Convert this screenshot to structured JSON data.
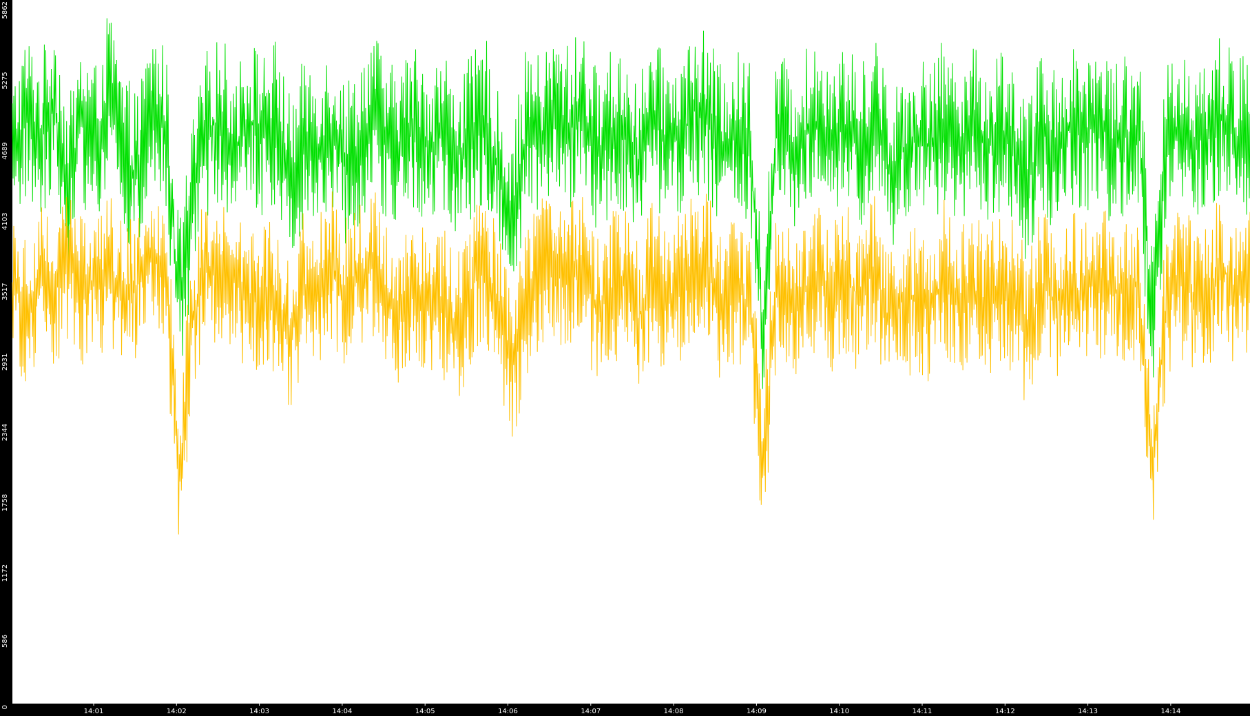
{
  "chart_data": {
    "type": "line",
    "title": "",
    "xlabel": "",
    "ylabel": "",
    "grid": false,
    "legend": "none",
    "x_range": [
      "14:00",
      "14:15"
    ],
    "ylim": [
      0,
      5862
    ],
    "y_ticks": [
      0,
      586,
      1172,
      1758,
      2344,
      2931,
      3517,
      4103,
      4689,
      5275,
      5862
    ],
    "x_ticks": [
      "14:01",
      "14:02",
      "14:03",
      "14:04",
      "14:05",
      "14:06",
      "14:07",
      "14:08",
      "14:09",
      "14:10",
      "14:11",
      "14:12",
      "14:13",
      "14:14"
    ],
    "series": [
      {
        "color": "#00e000",
        "values": [
          4500,
          4900,
          4700,
          5050,
          4300,
          4850,
          4650,
          5100,
          4550,
          4400,
          4950,
          4800,
          3300,
          4200,
          4750,
          4900,
          4600,
          4850,
          4750,
          4850,
          4350,
          4700,
          4650,
          4800,
          4500,
          4700,
          4950,
          4600,
          4700,
          4800,
          4650,
          4750,
          4550,
          4700,
          4900,
          4350,
          4100,
          4800,
          4700,
          4900,
          4800,
          4950,
          4600,
          4750,
          4800,
          4500,
          4850,
          4700,
          4700,
          4950,
          4900,
          4600,
          4750,
          4700,
          3100,
          4800,
          4600,
          4750,
          4850,
          4750,
          4800,
          4600,
          5000,
          4400,
          4600,
          4700,
          4650,
          4850,
          4700,
          4800,
          4650,
          4800,
          4700,
          4300,
          4750,
          4650,
          4800,
          4750,
          4850,
          4700,
          4750,
          4800,
          3100,
          4650,
          4800,
          4700,
          4750,
          4900,
          4700,
          4750
        ]
      },
      {
        "color": "#ffc000",
        "values": [
          3500,
          3300,
          3550,
          3400,
          3700,
          3450,
          3550,
          3600,
          3350,
          3500,
          3700,
          3600,
          1900,
          3200,
          3650,
          3500,
          3550,
          3400,
          3450,
          3400,
          3050,
          3500,
          3400,
          3650,
          3400,
          3550,
          3650,
          3350,
          3300,
          3500,
          3400,
          3350,
          3150,
          3450,
          3700,
          3250,
          2800,
          3350,
          3600,
          3700,
          3550,
          3650,
          3300,
          3450,
          3500,
          3200,
          3550,
          3350,
          3450,
          3700,
          3650,
          3300,
          3500,
          3300,
          2000,
          3600,
          3350,
          3450,
          3550,
          3400,
          3550,
          3350,
          3650,
          3200,
          3350,
          3400,
          3300,
          3550,
          3400,
          3450,
          3350,
          3500,
          3400,
          3100,
          3500,
          3350,
          3500,
          3400,
          3550,
          3400,
          3450,
          3500,
          2000,
          3350,
          3500,
          3400,
          3450,
          3650,
          3400,
          3500
        ]
      }
    ]
  }
}
